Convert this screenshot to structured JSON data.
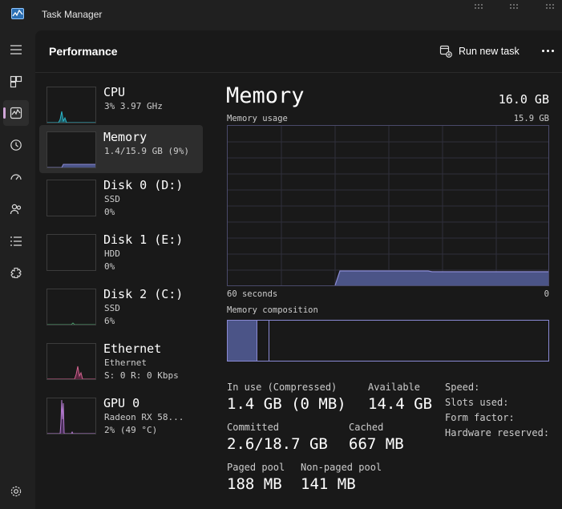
{
  "window": {
    "title": "Task Manager"
  },
  "colors": {
    "memory_accent": "#8a8ad4",
    "memory_fill": "#4b5487",
    "cpu": "#2ab5c9",
    "ethernet": "#d2648f",
    "gpu": "#b47ad0",
    "disk": "#4a9a6a"
  },
  "header": {
    "title": "Performance",
    "run_new_task": "Run new task"
  },
  "devices": [
    {
      "name": "CPU",
      "line1": "3% 3.97 GHz",
      "line2": ""
    },
    {
      "name": "Memory",
      "line1": "1.4/15.9 GB (9%)",
      "line2": ""
    },
    {
      "name": "Disk 0 (D:)",
      "line1": "SSD",
      "line2": "0%"
    },
    {
      "name": "Disk 1 (E:)",
      "line1": "HDD",
      "line2": "0%"
    },
    {
      "name": "Disk 2 (C:)",
      "line1": "SSD",
      "line2": "6%"
    },
    {
      "name": "Ethernet",
      "line1": "Ethernet",
      "line2": "S: 0 R: 0 Kbps"
    },
    {
      "name": "GPU 0",
      "line1": "Radeon RX 58...",
      "line2": "2% (49 °C)"
    }
  ],
  "detail": {
    "title": "Memory",
    "total": "16.0 GB",
    "usage_label": "Memory usage",
    "usage_max": "15.9 GB",
    "time_left": "60 seconds",
    "time_right": "0",
    "composition_label": "Memory composition",
    "stats": {
      "in_use_label": "In use (Compressed)",
      "in_use_value": "1.4 GB (0 MB)",
      "available_label": "Available",
      "available_value": "14.4 GB",
      "committed_label": "Committed",
      "committed_value": "2.6/18.7 GB",
      "cached_label": "Cached",
      "cached_value": "667 MB",
      "paged_label": "Paged pool",
      "paged_value": "188 MB",
      "nonpaged_label": "Non-paged pool",
      "nonpaged_value": "141 MB"
    },
    "properties": {
      "speed": "Speed:",
      "slots": "Slots used:",
      "form_factor": "Form factor:",
      "hw_reserved": "Hardware reserved:"
    }
  },
  "icons": {
    "rail": [
      "hamburger-icon",
      "processes-icon",
      "performance-icon",
      "app-history-icon",
      "startup-icon",
      "users-icon",
      "details-icon",
      "services-icon",
      "settings-icon"
    ]
  }
}
